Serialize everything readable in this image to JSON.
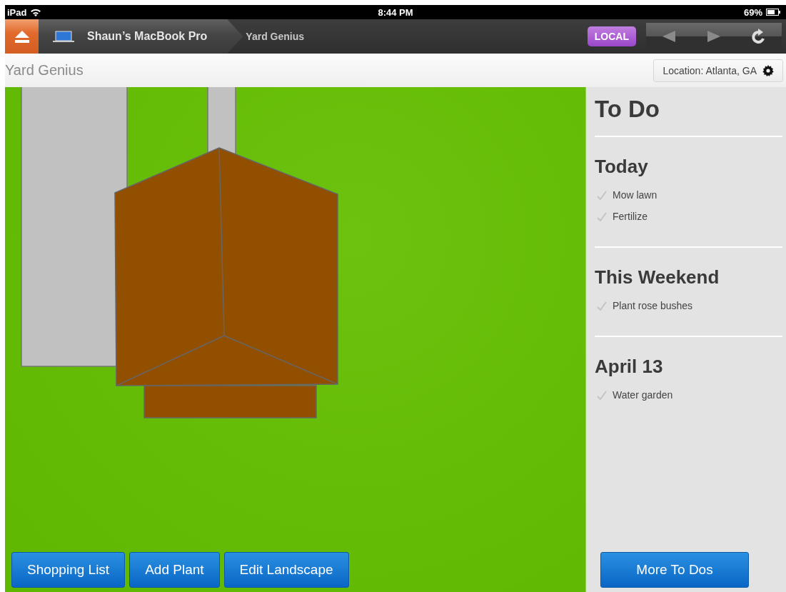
{
  "status_bar": {
    "carrier": "iPad",
    "time": "8:44 PM",
    "battery": "69%"
  },
  "nav_bar": {
    "breadcrumbs": [
      {
        "label": "Shaun’s MacBook Pro",
        "selected": false
      },
      {
        "label": "Yard Genius",
        "selected": true
      }
    ],
    "badge": "LOCAL"
  },
  "header": {
    "title": "Yard Genius",
    "location_button": "Location: Atlanta, GA"
  },
  "toolbar": {
    "buttons": [
      "Shopping List",
      "Add Plant",
      "Edit Landscape"
    ]
  },
  "todo": {
    "title": "To Do",
    "sections": [
      {
        "heading": "Today",
        "items": [
          {
            "label": "Mow lawn",
            "done": false
          },
          {
            "label": "Fertilize",
            "done": false
          }
        ]
      },
      {
        "heading": "This Weekend",
        "items": [
          {
            "label": "Plant rose bushes",
            "done": false
          }
        ]
      },
      {
        "heading": "April 13",
        "items": [
          {
            "label": "Water garden",
            "done": false
          }
        ]
      }
    ],
    "more_button": "More To Dos"
  }
}
